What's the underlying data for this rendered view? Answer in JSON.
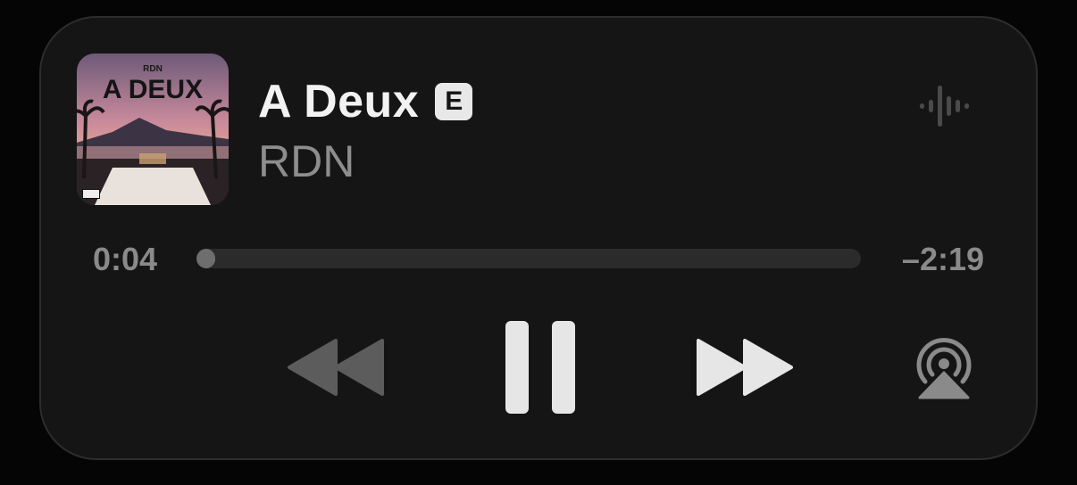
{
  "now_playing": {
    "title": "A Deux",
    "explicit_badge": "E",
    "artist": "RDN",
    "artwork_icon": "album-artwork",
    "waveform_icon": "audio-waveform-icon"
  },
  "playback": {
    "elapsed": "0:04",
    "remaining": "–2:19",
    "progress_fraction": 0.028
  },
  "controls": {
    "rewind_icon": "rewind-icon",
    "pause_icon": "pause-icon",
    "forward_icon": "fast-forward-icon",
    "airplay_icon": "airplay-audio-icon"
  },
  "colors": {
    "panel": "#151515",
    "primary_text": "#f2f2f2",
    "secondary_text": "#8d8d8d",
    "control_active": "#e6e6e6",
    "control_disabled": "#5c5c5c"
  }
}
